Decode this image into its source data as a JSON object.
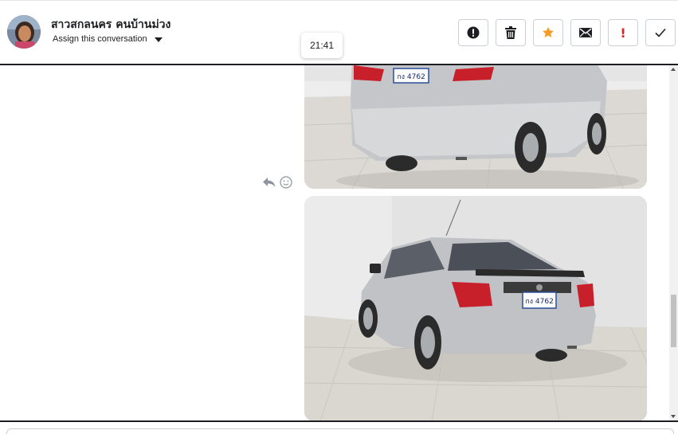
{
  "header": {
    "contact_name": "สาวสกลนคร คนบ้านม่วง",
    "assign_label": "Assign this conversation",
    "actions": [
      {
        "name": "spam-button",
        "icon": "alert-circle-icon"
      },
      {
        "name": "delete-button",
        "icon": "trash-icon"
      },
      {
        "name": "star-button",
        "icon": "star-icon"
      },
      {
        "name": "mark-unread-button",
        "icon": "envelope-icon"
      },
      {
        "name": "important-button",
        "icon": "exclamation-icon",
        "label": "!"
      },
      {
        "name": "done-button",
        "icon": "checkmark-icon"
      }
    ]
  },
  "tooltip": {
    "time": "21:41"
  },
  "messages": {
    "photos": [
      {
        "subject": "silver sedan rear view (top cropped)",
        "plate": "กง 4762"
      },
      {
        "subject": "silver sedan rear three-quarter view",
        "plate": "กง 4762"
      }
    ],
    "reactions": {
      "reply_icon": "reply-icon",
      "emoji_icon": "smiley-icon"
    }
  },
  "colors": {
    "star": "#f59a23",
    "important": "#e02424",
    "divider": "#1c1e21",
    "button_border": "#ccd0d5"
  }
}
